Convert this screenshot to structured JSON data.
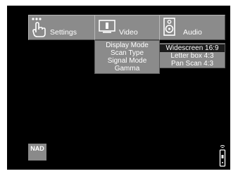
{
  "tabs": [
    {
      "label": "Settings",
      "icon": "hand-pointer-icon"
    },
    {
      "label": "Video",
      "icon": "video-screen-icon"
    },
    {
      "label": "Audio",
      "icon": "speaker-icon"
    }
  ],
  "video_menu": {
    "items": [
      "Display Mode",
      "Scan Type",
      "Signal Mode",
      "Gamma"
    ],
    "selected": "Display Mode"
  },
  "display_mode_menu": {
    "items": [
      "Widescreen 16:9",
      "Letter box 4:3",
      "Pan Scan 4:3"
    ],
    "selected": "Widescreen 16:9"
  },
  "brand": {
    "logo": "NAD"
  },
  "status": {
    "remote_icon": "remote-control-icon"
  },
  "colors": {
    "background": "#000000",
    "panel": "#8b8b8b",
    "highlight": "#1c1c1c",
    "text": "#ffffff"
  }
}
